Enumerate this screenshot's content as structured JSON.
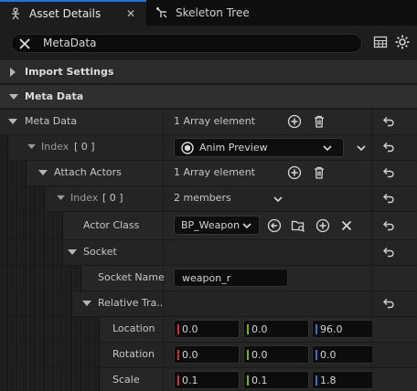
{
  "tabs": [
    {
      "label": "Asset Details"
    },
    {
      "label": "Skeleton Tree"
    }
  ],
  "search": {
    "value": "MetaData"
  },
  "categories": {
    "import_settings": "Import Settings",
    "meta_data": "Meta Data"
  },
  "rows": {
    "meta_data": {
      "label": "Meta Data",
      "value": "1 Array element"
    },
    "index0": {
      "label": "Index",
      "index": "[ 0 ]",
      "combo": "Anim Preview"
    },
    "attach_actors": {
      "label": "Attach Actors",
      "value": "1 Array element"
    },
    "index0_inner": {
      "label": "Index",
      "index": "[ 0 ]",
      "value": "2 members"
    },
    "actor_class": {
      "label": "Actor Class",
      "combo": "BP_Weapon"
    },
    "socket": {
      "label": "Socket"
    },
    "socket_name": {
      "label": "Socket Name",
      "value": "weapon_r"
    },
    "relative_transform": {
      "label": "Relative Tra..."
    },
    "location": {
      "label": "Location",
      "x": "0.0",
      "y": "0.0",
      "z": "96.0"
    },
    "rotation": {
      "label": "Rotation",
      "x": "0.0",
      "y": "0.0",
      "z": "0.0"
    },
    "scale": {
      "label": "Scale",
      "x": "0.1",
      "y": "0.1",
      "z": "1.8"
    }
  },
  "colors": {
    "accent": "#1f74d9",
    "axis_x": "#c73434",
    "axis_y": "#6fb51f",
    "axis_z": "#2f73d0"
  }
}
